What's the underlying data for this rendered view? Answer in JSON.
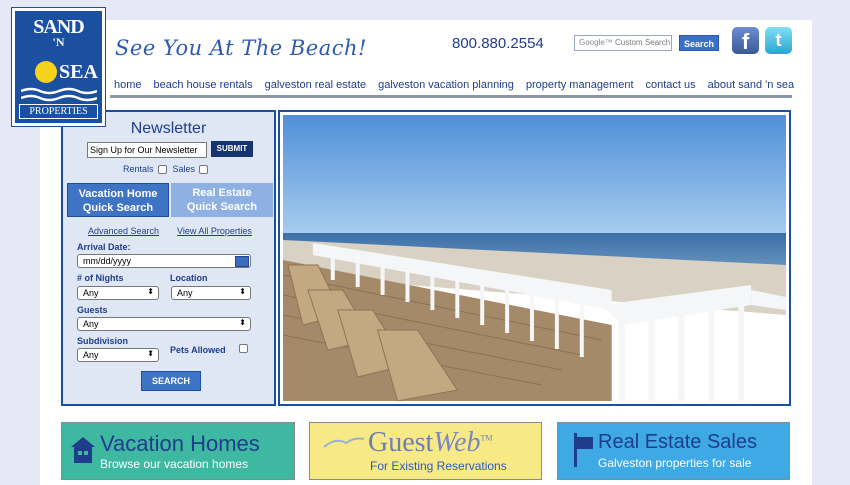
{
  "logo": {
    "line1": "SAND",
    "line2": "'N",
    "line3": "SEA",
    "line4": "PROPERTIES"
  },
  "header": {
    "tagline": "See You At The Beach!",
    "phone": "800.880.2554",
    "search_placeholder_brand": "Google™",
    "search_placeholder": "Custom Search",
    "search_button": "Search",
    "social": {
      "facebook": "f",
      "twitter": "t"
    }
  },
  "nav": {
    "items": [
      {
        "label": "home"
      },
      {
        "label": "beach house rentals"
      },
      {
        "label": "galveston real estate"
      },
      {
        "label": "galveston vacation planning"
      },
      {
        "label": "property management"
      },
      {
        "label": "contact us"
      },
      {
        "label": "about sand 'n sea"
      }
    ]
  },
  "sidebar": {
    "newsletter_title": "Newsletter",
    "newsletter_input_value": "Sign Up for Our Newsletter",
    "submit_label": "SUBMIT",
    "rentals_label": "Rentals",
    "sales_label": "Sales",
    "tab_vacation": {
      "line1": "Vacation Home",
      "line2": "Quick Search"
    },
    "tab_realestate": {
      "line1": "Real Estate",
      "line2": "Quick Search"
    },
    "advanced_search": "Advanced Search",
    "view_all": "View All Properties",
    "arrival_label": "Arrival Date:",
    "arrival_value": "mm/dd/yyyy",
    "nights_label": "# of Nights",
    "nights_value": "Any",
    "location_label": "Location",
    "location_value": "Any",
    "guests_label": "Guests",
    "guests_value": "Any",
    "subdivision_label": "Subdivision",
    "subdivision_value": "Any",
    "pets_label": "Pets Allowed",
    "search_button": "SEARCH"
  },
  "banners": {
    "vacation": {
      "title": "Vacation Homes",
      "subtitle": "Browse our vacation homes"
    },
    "guestweb": {
      "title_a": "Guest",
      "title_b": "Web",
      "tm": "TM",
      "subtitle": "For Existing Reservations"
    },
    "realestate": {
      "title": "Real Estate Sales",
      "subtitle": "Galveston properties for sale"
    }
  },
  "colors": {
    "brand_blue": "#1b4fa0",
    "background": "#e6e8f8",
    "vacation_banner": "#3fb8a2",
    "guestweb_banner": "#f7ea86",
    "realestate_banner": "#3fa9e6"
  }
}
